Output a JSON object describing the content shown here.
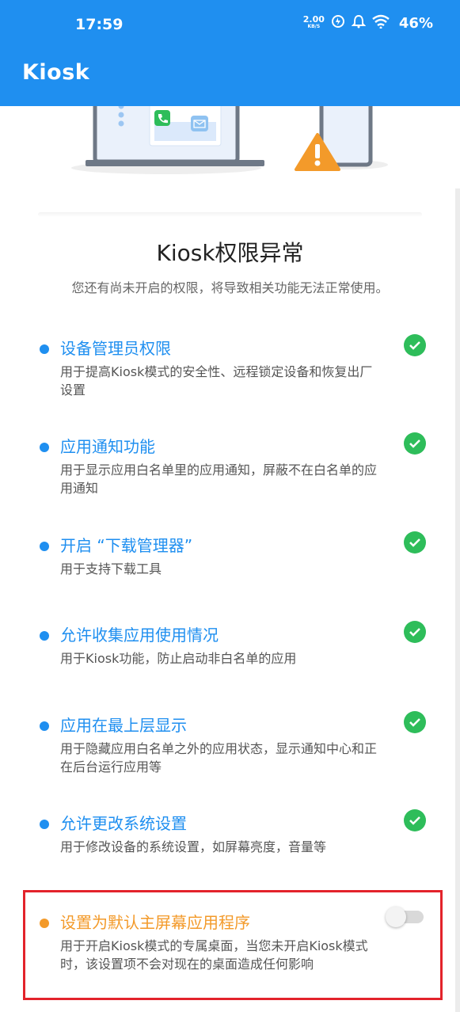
{
  "status": {
    "time": "17:59",
    "net_speed": "2.00",
    "net_unit": "KB/S",
    "battery": "46%"
  },
  "app": {
    "title": "Kiosk",
    "accent": "#1f8ff0"
  },
  "content": {
    "headline": "Kiosk权限异常",
    "subline": "您还有尚未开启的权限，将导致相关功能无法正常使用。"
  },
  "permissions": [
    {
      "title": "设备管理员权限",
      "desc": "用于提高Kiosk模式的安全性、远程锁定设备和恢复出厂设置",
      "enabled": true
    },
    {
      "title": "应用通知功能",
      "desc": "用于显示应用白名单里的应用通知，屏蔽不在白名单的应用通知",
      "enabled": true
    },
    {
      "title": "开启 “下载管理器”",
      "desc": "用于支持下载工具",
      "enabled": true
    },
    {
      "title": "允许收集应用使用情况",
      "desc": "用于Kiosk功能，防止启动非白名单的应用",
      "enabled": true
    },
    {
      "title": "应用在最上层显示",
      "desc": "用于隐藏应用白名单之外的应用状态，显示通知中心和正在后台运行应用等",
      "enabled": true
    },
    {
      "title": "允许更改系统设置",
      "desc": "用于修改设备的系统设置，如屏幕亮度，音量等",
      "enabled": true
    },
    {
      "title": "设置为默认主屏幕应用程序",
      "desc": "用于开启Kiosk模式的专属桌面，当您未开启Kiosk模式时，该设置项不会对现在的桌面造成任何影响",
      "enabled": false
    }
  ],
  "colors": {
    "check": "#2ebd5a",
    "warning": "#f39a2a",
    "highlight": "#e3232b"
  },
  "icons": [
    "net-speed-icon",
    "data-saver-icon",
    "alarm-icon",
    "wifi-icon",
    "phone-icon",
    "mail-icon",
    "warning-icon",
    "check-icon"
  ]
}
